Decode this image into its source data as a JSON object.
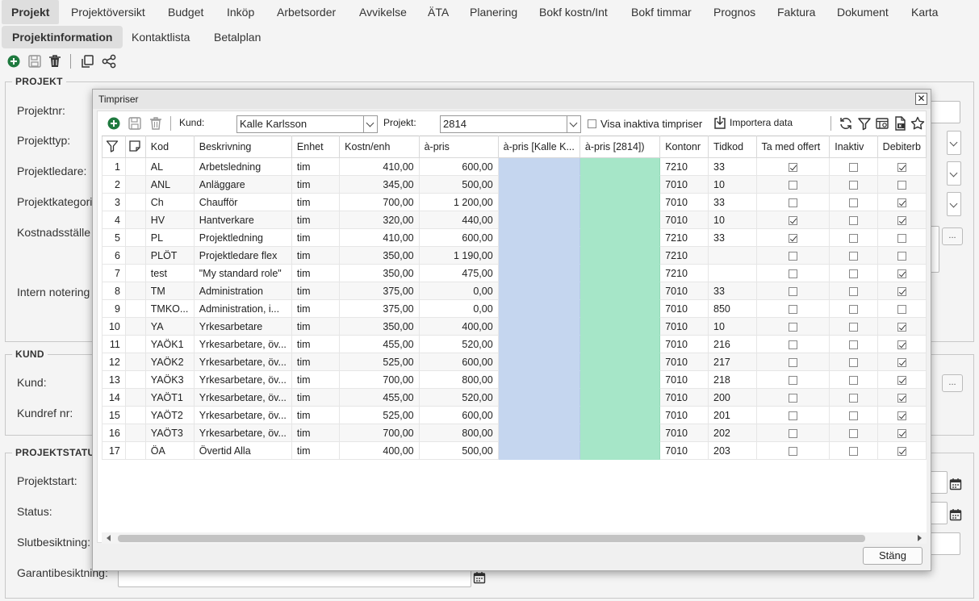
{
  "tabs_main": [
    "Projekt",
    "Projektöversikt",
    "Budget",
    "Inköp",
    "Arbetsorder",
    "Avvikelse",
    "ÄTA",
    "Planering",
    "Bokf kostn/Int",
    "Bokf timmar",
    "Prognos",
    "Faktura",
    "Dokument",
    "Karta"
  ],
  "tabs_sub": [
    "Projektinformation",
    "Kontaktlista",
    "Betalplan"
  ],
  "form": {
    "projekt_legend": "PROJEKT",
    "projektnr": "Projektnr:",
    "projekttyp": "Projekttyp:",
    "projektledare": "Projektledare:",
    "projektkategori": "Projektkategori",
    "kostnadsstalle": "Kostnadsställe",
    "intern_notering": "Intern notering",
    "kund_legend": "KUND",
    "kund": "Kund:",
    "kundref": "Kundref nr:",
    "status_legend": "PROJEKTSTATUS",
    "projektstart": "Projektstart:",
    "status": "Status:",
    "slutbesiktning": "Slutbesiktning:",
    "garantibesiktning": "Garantibesiktning:",
    "dots": "..."
  },
  "dialog": {
    "title": "Timpriser",
    "close_glyph": "✕",
    "kund_label": "Kund:",
    "kund_value": "Kalle Karlsson",
    "projekt_label": "Projekt:",
    "projekt_value": "2814",
    "show_inactive": "Visa inaktiva timpriser",
    "import": "Importera data",
    "close_button": "Stäng",
    "columns": [
      "Kod",
      "Beskrivning",
      "Enhet",
      "Kostn/enh",
      "à-pris",
      "à-pris [Kalle K...",
      "à-pris [2814])",
      "Kontonr",
      "Tidkod",
      "Ta med offert",
      "Inaktiv",
      "Debiterb"
    ],
    "rows": [
      {
        "n": "1",
        "kod": "AL",
        "beskr": "Arbetsledning",
        "enhet": "tim",
        "kostn": "410,00",
        "pris": "600,00",
        "konto": "7210",
        "tidkod": "33",
        "offert": true,
        "inaktiv": false,
        "debit": true
      },
      {
        "n": "2",
        "kod": "ANL",
        "beskr": "Anläggare",
        "enhet": "tim",
        "kostn": "345,00",
        "pris": "500,00",
        "konto": "7010",
        "tidkod": "10",
        "offert": false,
        "inaktiv": false,
        "debit": false
      },
      {
        "n": "3",
        "kod": "Ch",
        "beskr": "Chaufför",
        "enhet": "tim",
        "kostn": "700,00",
        "pris": "1 200,00",
        "konto": "7010",
        "tidkod": "33",
        "offert": false,
        "inaktiv": false,
        "debit": true
      },
      {
        "n": "4",
        "kod": "HV",
        "beskr": "Hantverkare",
        "enhet": "tim",
        "kostn": "320,00",
        "pris": "440,00",
        "konto": "7010",
        "tidkod": "10",
        "offert": true,
        "inaktiv": false,
        "debit": true
      },
      {
        "n": "5",
        "kod": "PL",
        "beskr": "Projektledning",
        "enhet": "tim",
        "kostn": "410,00",
        "pris": "600,00",
        "konto": "7210",
        "tidkod": "33",
        "offert": true,
        "inaktiv": false,
        "debit": false
      },
      {
        "n": "6",
        "kod": "PLÖT",
        "beskr": "Projektledare flex",
        "enhet": "tim",
        "kostn": "350,00",
        "pris": "1 190,00",
        "konto": "7210",
        "tidkod": "",
        "offert": false,
        "inaktiv": false,
        "debit": false
      },
      {
        "n": "7",
        "kod": "test",
        "beskr": "\"My standard role\"",
        "enhet": "tim",
        "kostn": "350,00",
        "pris": "475,00",
        "konto": "7210",
        "tidkod": "",
        "offert": false,
        "inaktiv": false,
        "debit": true
      },
      {
        "n": "8",
        "kod": "TM",
        "beskr": "Administration",
        "enhet": "tim",
        "kostn": "375,00",
        "pris": "0,00",
        "konto": "7010",
        "tidkod": "33",
        "offert": false,
        "inaktiv": false,
        "debit": true
      },
      {
        "n": "9",
        "kod": "TMKO...",
        "beskr": "Administration, i...",
        "enhet": "tim",
        "kostn": "375,00",
        "pris": "0,00",
        "konto": "7010",
        "tidkod": "850",
        "offert": false,
        "inaktiv": false,
        "debit": false
      },
      {
        "n": "10",
        "kod": "YA",
        "beskr": "Yrkesarbetare",
        "enhet": "tim",
        "kostn": "350,00",
        "pris": "400,00",
        "konto": "7010",
        "tidkod": "10",
        "offert": false,
        "inaktiv": false,
        "debit": true
      },
      {
        "n": "11",
        "kod": "YAÖK1",
        "beskr": "Yrkesarbetare, öv...",
        "enhet": "tim",
        "kostn": "455,00",
        "pris": "520,00",
        "konto": "7010",
        "tidkod": "216",
        "offert": false,
        "inaktiv": false,
        "debit": true
      },
      {
        "n": "12",
        "kod": "YAÖK2",
        "beskr": "Yrkesarbetare, öv...",
        "enhet": "tim",
        "kostn": "525,00",
        "pris": "600,00",
        "konto": "7010",
        "tidkod": "217",
        "offert": false,
        "inaktiv": false,
        "debit": true
      },
      {
        "n": "13",
        "kod": "YAÖK3",
        "beskr": "Yrkesarbetare, öv...",
        "enhet": "tim",
        "kostn": "700,00",
        "pris": "800,00",
        "konto": "7010",
        "tidkod": "218",
        "offert": false,
        "inaktiv": false,
        "debit": true
      },
      {
        "n": "14",
        "kod": "YAÖT1",
        "beskr": "Yrkesarbetare, öv...",
        "enhet": "tim",
        "kostn": "455,00",
        "pris": "520,00",
        "konto": "7010",
        "tidkod": "200",
        "offert": false,
        "inaktiv": false,
        "debit": true
      },
      {
        "n": "15",
        "kod": "YAÖT2",
        "beskr": "Yrkesarbetare, öv...",
        "enhet": "tim",
        "kostn": "525,00",
        "pris": "600,00",
        "konto": "7010",
        "tidkod": "201",
        "offert": false,
        "inaktiv": false,
        "debit": true
      },
      {
        "n": "16",
        "kod": "YAÖT3",
        "beskr": "Yrkesarbetare, öv...",
        "enhet": "tim",
        "kostn": "700,00",
        "pris": "800,00",
        "konto": "7010",
        "tidkod": "202",
        "offert": false,
        "inaktiv": false,
        "debit": true
      },
      {
        "n": "17",
        "kod": "ÖA",
        "beskr": "Övertid Alla",
        "enhet": "tim",
        "kostn": "400,00",
        "pris": "500,00",
        "konto": "7010",
        "tidkod": "203",
        "offert": false,
        "inaktiv": false,
        "debit": true
      }
    ]
  },
  "colors": {
    "accent_green": "#1f7a3f",
    "customer_price_column": "#c5d6ef",
    "project_price_column": "#a6e6c8"
  }
}
